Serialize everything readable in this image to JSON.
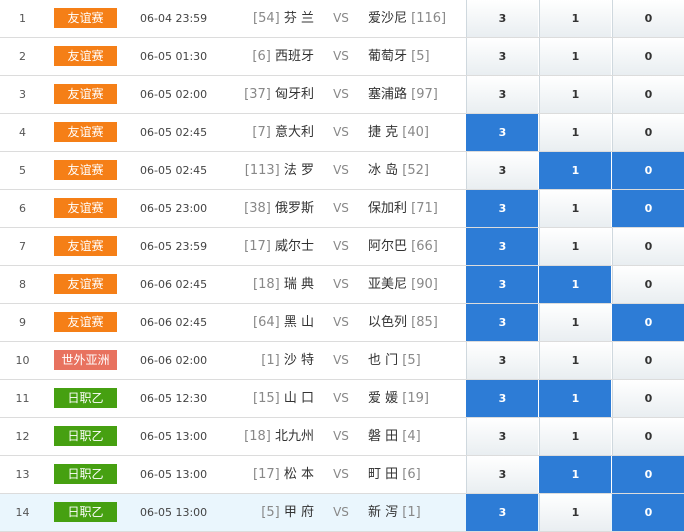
{
  "colors": {
    "friendly": "#f57f17",
    "wc_asia": "#e8725f",
    "jleague": "#46a011",
    "selected": "#2d7cd6"
  },
  "rows": [
    {
      "num": "1",
      "league": "友谊赛",
      "league_color": "#f57f17",
      "time": "06-04 23:59",
      "home_rank": "[54]",
      "home": "芬 兰",
      "vs": "VS",
      "away": "爱沙尼",
      "away_rank": "[116]",
      "odds": [
        "3",
        "1",
        "0"
      ],
      "selected": [
        false,
        false,
        false
      ],
      "highlight": false
    },
    {
      "num": "2",
      "league": "友谊赛",
      "league_color": "#f57f17",
      "time": "06-05 01:30",
      "home_rank": "[6]",
      "home": "西班牙",
      "vs": "VS",
      "away": "葡萄牙",
      "away_rank": "[5]",
      "odds": [
        "3",
        "1",
        "0"
      ],
      "selected": [
        false,
        false,
        false
      ],
      "highlight": false
    },
    {
      "num": "3",
      "league": "友谊赛",
      "league_color": "#f57f17",
      "time": "06-05 02:00",
      "home_rank": "[37]",
      "home": "匈牙利",
      "vs": "VS",
      "away": "塞浦路",
      "away_rank": "[97]",
      "odds": [
        "3",
        "1",
        "0"
      ],
      "selected": [
        false,
        false,
        false
      ],
      "highlight": false
    },
    {
      "num": "4",
      "league": "友谊赛",
      "league_color": "#f57f17",
      "time": "06-05 02:45",
      "home_rank": "[7]",
      "home": "意大利",
      "vs": "VS",
      "away": "捷 克",
      "away_rank": "[40]",
      "odds": [
        "3",
        "1",
        "0"
      ],
      "selected": [
        true,
        false,
        false
      ],
      "highlight": false
    },
    {
      "num": "5",
      "league": "友谊赛",
      "league_color": "#f57f17",
      "time": "06-05 02:45",
      "home_rank": "[113]",
      "home": "法 罗",
      "vs": "VS",
      "away": "冰 岛",
      "away_rank": "[52]",
      "odds": [
        "3",
        "1",
        "0"
      ],
      "selected": [
        false,
        true,
        true
      ],
      "highlight": false
    },
    {
      "num": "6",
      "league": "友谊赛",
      "league_color": "#f57f17",
      "time": "06-05 23:00",
      "home_rank": "[38]",
      "home": "俄罗斯",
      "vs": "VS",
      "away": "保加利",
      "away_rank": "[71]",
      "odds": [
        "3",
        "1",
        "0"
      ],
      "selected": [
        true,
        false,
        true
      ],
      "highlight": false
    },
    {
      "num": "7",
      "league": "友谊赛",
      "league_color": "#f57f17",
      "time": "06-05 23:59",
      "home_rank": "[17]",
      "home": "威尔士",
      "vs": "VS",
      "away": "阿尔巴",
      "away_rank": "[66]",
      "odds": [
        "3",
        "1",
        "0"
      ],
      "selected": [
        true,
        false,
        false
      ],
      "highlight": false
    },
    {
      "num": "8",
      "league": "友谊赛",
      "league_color": "#f57f17",
      "time": "06-06 02:45",
      "home_rank": "[18]",
      "home": "瑞 典",
      "vs": "VS",
      "away": "亚美尼",
      "away_rank": "[90]",
      "odds": [
        "3",
        "1",
        "0"
      ],
      "selected": [
        true,
        true,
        false
      ],
      "highlight": false
    },
    {
      "num": "9",
      "league": "友谊赛",
      "league_color": "#f57f17",
      "time": "06-06 02:45",
      "home_rank": "[64]",
      "home": "黑 山",
      "vs": "VS",
      "away": "以色列",
      "away_rank": "[85]",
      "odds": [
        "3",
        "1",
        "0"
      ],
      "selected": [
        true,
        false,
        true
      ],
      "highlight": false
    },
    {
      "num": "10",
      "league": "世外亚洲",
      "league_color": "#e8725f",
      "time": "06-06 02:00",
      "home_rank": "[1]",
      "home": "沙 特",
      "vs": "VS",
      "away": "也 门",
      "away_rank": "[5]",
      "odds": [
        "3",
        "1",
        "0"
      ],
      "selected": [
        false,
        false,
        false
      ],
      "highlight": false
    },
    {
      "num": "11",
      "league": "日职乙",
      "league_color": "#46a011",
      "time": "06-05 12:30",
      "home_rank": "[15]",
      "home": "山 口",
      "vs": "VS",
      "away": "爱 媛",
      "away_rank": "[19]",
      "odds": [
        "3",
        "1",
        "0"
      ],
      "selected": [
        true,
        true,
        false
      ],
      "highlight": false
    },
    {
      "num": "12",
      "league": "日职乙",
      "league_color": "#46a011",
      "time": "06-05 13:00",
      "home_rank": "[18]",
      "home": "北九州",
      "vs": "VS",
      "away": "磐 田",
      "away_rank": "[4]",
      "odds": [
        "3",
        "1",
        "0"
      ],
      "selected": [
        false,
        false,
        false
      ],
      "highlight": false
    },
    {
      "num": "13",
      "league": "日职乙",
      "league_color": "#46a011",
      "time": "06-05 13:00",
      "home_rank": "[17]",
      "home": "松 本",
      "vs": "VS",
      "away": "町 田",
      "away_rank": "[6]",
      "odds": [
        "3",
        "1",
        "0"
      ],
      "selected": [
        false,
        true,
        true
      ],
      "highlight": false
    },
    {
      "num": "14",
      "league": "日职乙",
      "league_color": "#46a011",
      "time": "06-05 13:00",
      "home_rank": "[5]",
      "home": "甲 府",
      "vs": "VS",
      "away": "新 泻",
      "away_rank": "[1]",
      "odds": [
        "3",
        "1",
        "0"
      ],
      "selected": [
        true,
        false,
        true
      ],
      "highlight": true
    }
  ]
}
